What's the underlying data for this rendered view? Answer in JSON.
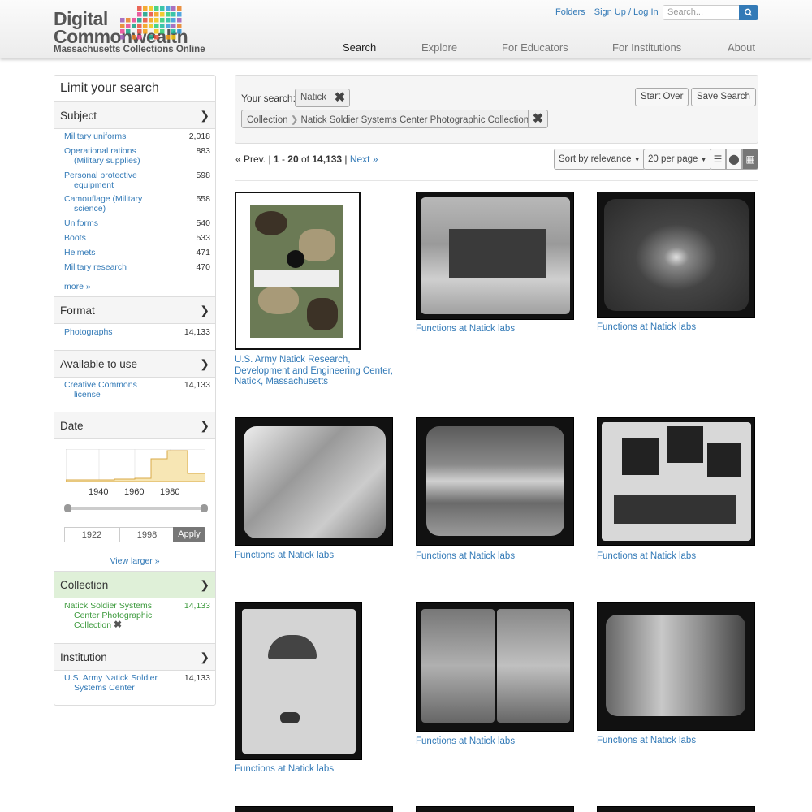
{
  "header": {
    "logo": {
      "line1": "Digital",
      "line2": "Commonwealth",
      "line3": "Massachusetts Collections Online"
    },
    "utility_links": [
      "Folders",
      "Sign Up / Log In"
    ],
    "search": {
      "placeholder": "Search..."
    },
    "nav": [
      "Search",
      "Explore",
      "For Educators",
      "For Institutions",
      "About"
    ],
    "active_nav": "Search"
  },
  "sidebar": {
    "title": "Limit your search",
    "subject": {
      "heading": "Subject",
      "items": [
        {
          "label": "Military uniforms",
          "count": "2,018"
        },
        {
          "label": "Operational rations",
          "label2": "(Military supplies)",
          "count": "883"
        },
        {
          "label": "Personal protective",
          "label2": "equipment",
          "count": "598"
        },
        {
          "label": "Camouflage (Military",
          "label2": "science)",
          "count": "558"
        },
        {
          "label": "Uniforms",
          "count": "540"
        },
        {
          "label": "Boots",
          "count": "533"
        },
        {
          "label": "Helmets",
          "count": "471"
        },
        {
          "label": "Military research",
          "count": "470"
        }
      ],
      "more": "more »"
    },
    "format": {
      "heading": "Format",
      "items": [
        {
          "label": "Photographs",
          "count": "14,133"
        }
      ]
    },
    "available": {
      "heading": "Available to use",
      "items": [
        {
          "label": "Creative Commons",
          "label2": "license",
          "count": "14,133"
        }
      ]
    },
    "date": {
      "heading": "Date",
      "years": [
        "1940",
        "1960",
        "1980"
      ],
      "from": "1922",
      "to": "1998",
      "apply": "Apply",
      "view_larger": "View larger »"
    },
    "collection": {
      "heading": "Collection",
      "items": [
        {
          "label": "Natick Soldier Systems",
          "label2": "Center Photographic",
          "label3": "Collection",
          "count": "14,133"
        }
      ]
    },
    "institution": {
      "heading": "Institution",
      "items": [
        {
          "label": "U.S. Army Natick Soldier",
          "label2": "Systems Center",
          "count": "14,133"
        }
      ]
    }
  },
  "constraints": {
    "label": "Your search:",
    "query": "Natick",
    "filter_field": "Collection",
    "filter_value": "Natick Soldier Systems Center Photographic Collection",
    "start_over": "Start Over",
    "save_search": "Save Search"
  },
  "results": {
    "prev": "« Prev.",
    "range_start": "1",
    "range_end": "20",
    "of": "of",
    "total": "14,133",
    "next": "Next »",
    "sort": "Sort by relevance",
    "per_page": "20 per page",
    "items": [
      {
        "caption": "U.S. Army Natick Research, Development and Engineering Center, Natick, Massachusetts"
      },
      {
        "caption": "Functions at Natick labs"
      },
      {
        "caption": "Functions at Natick labs"
      },
      {
        "caption": "Functions at Natick labs"
      },
      {
        "caption": "Functions at Natick labs"
      },
      {
        "caption": "Functions at Natick labs"
      },
      {
        "caption": "Functions at Natick labs"
      },
      {
        "caption": "Functions at Natick labs"
      },
      {
        "caption": "Functions at Natick labs"
      }
    ]
  }
}
